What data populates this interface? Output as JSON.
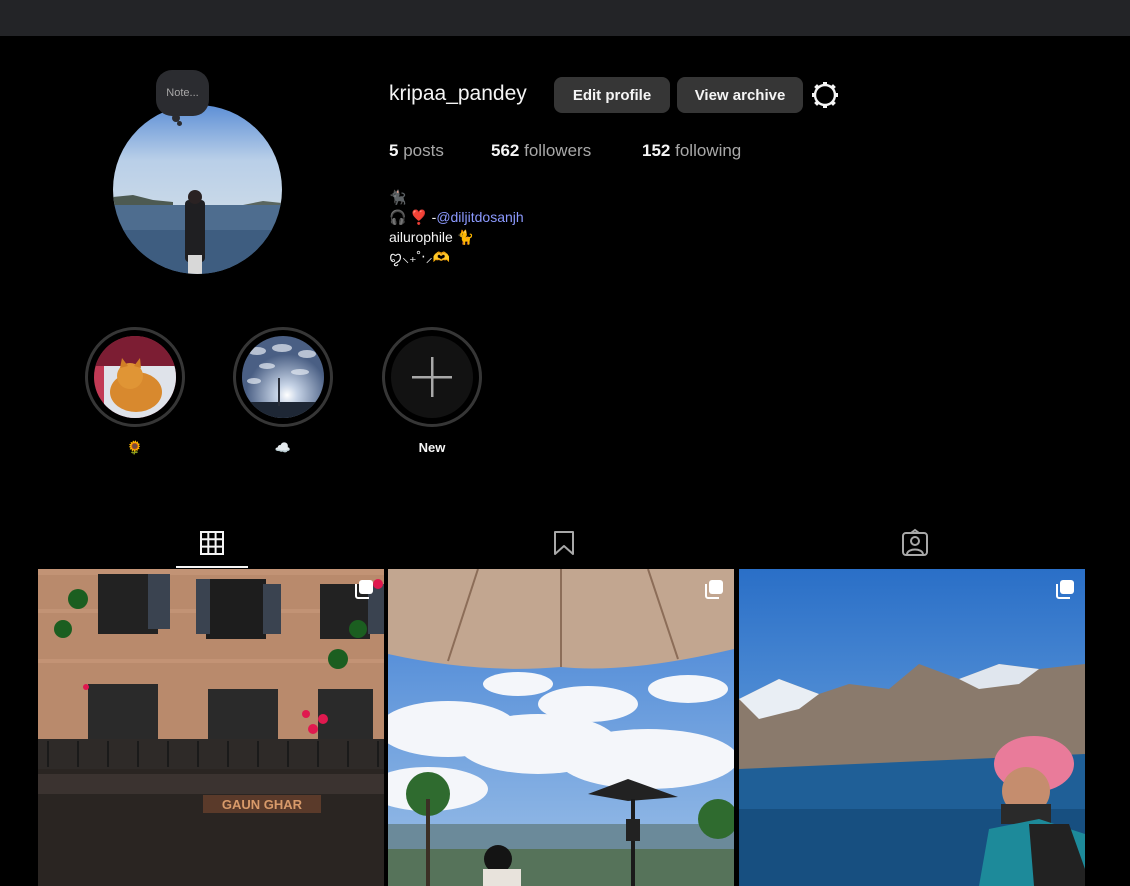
{
  "profile": {
    "username": "kripaa_pandey",
    "note_text": "Note...",
    "edit_profile_label": "Edit profile",
    "view_archive_label": "View archive",
    "posts_count": "5",
    "posts_label": "posts",
    "followers_count": "562",
    "followers_label": "followers",
    "following_count": "152",
    "following_label": "following",
    "bio": {
      "line1": "🐈‍⬛",
      "line2_prefix": "🎧 ❣️ -",
      "line2_mention": "@diljitdosanjh",
      "line3": "ailurophile 🐈",
      "line4": "ꨄ︎⸜₊˚‧⸝🫶"
    }
  },
  "highlights": [
    {
      "label": "🌻"
    },
    {
      "label": "☁️"
    },
    {
      "label": "New"
    }
  ],
  "tabs": [
    {
      "name": "posts",
      "icon": "grid-icon",
      "active": true
    },
    {
      "name": "saved",
      "icon": "bookmark-icon",
      "active": false
    },
    {
      "name": "tagged",
      "icon": "tagged-user-icon",
      "active": false
    }
  ],
  "posts": [
    {
      "sign_text": "GAUN GHAR",
      "multi": true
    },
    {
      "multi": true
    },
    {
      "multi": true
    }
  ],
  "colors": {
    "background": "#000000",
    "topbar": "#232427",
    "button": "#363636",
    "mention": "#8c9aff",
    "muted_text": "#a8a8a8"
  }
}
